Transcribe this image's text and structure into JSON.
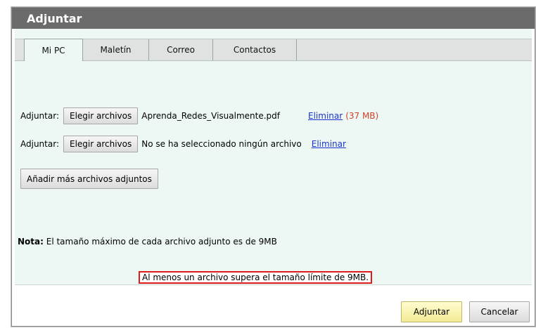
{
  "dialog": {
    "title": "Adjuntar"
  },
  "tabs": [
    {
      "label": "Mi PC"
    },
    {
      "label": "Maletín"
    },
    {
      "label": "Correo"
    },
    {
      "label": "Contactos"
    }
  ],
  "attachments": [
    {
      "label": "Adjuntar:",
      "choose_button": "Elegir archivos",
      "filename": "Aprenda_Redes_Visualmente.pdf",
      "remove_link": "Eliminar",
      "size": "(37 MB)"
    },
    {
      "label": "Adjuntar:",
      "choose_button": "Elegir archivos",
      "filename": "No se ha seleccionado ningún archivo",
      "remove_link": "Eliminar"
    }
  ],
  "add_more_button": "Añadir más archivos adjuntos",
  "note": {
    "bold": "Nota:",
    "text": " El tamaño máximo de cada archivo adjunto es de 9MB"
  },
  "error_message": "Al menos un archivo supera el tamaño límite de 9MB.",
  "footer": {
    "attach_button": "Adjuntar",
    "cancel_button": "Cancelar"
  },
  "colors": {
    "title_bar": "#6b6b6b",
    "panel_bg": "#edf8f4",
    "error_border": "#e11a1a",
    "link": "#1a33cc",
    "size_text": "#d0412c"
  }
}
